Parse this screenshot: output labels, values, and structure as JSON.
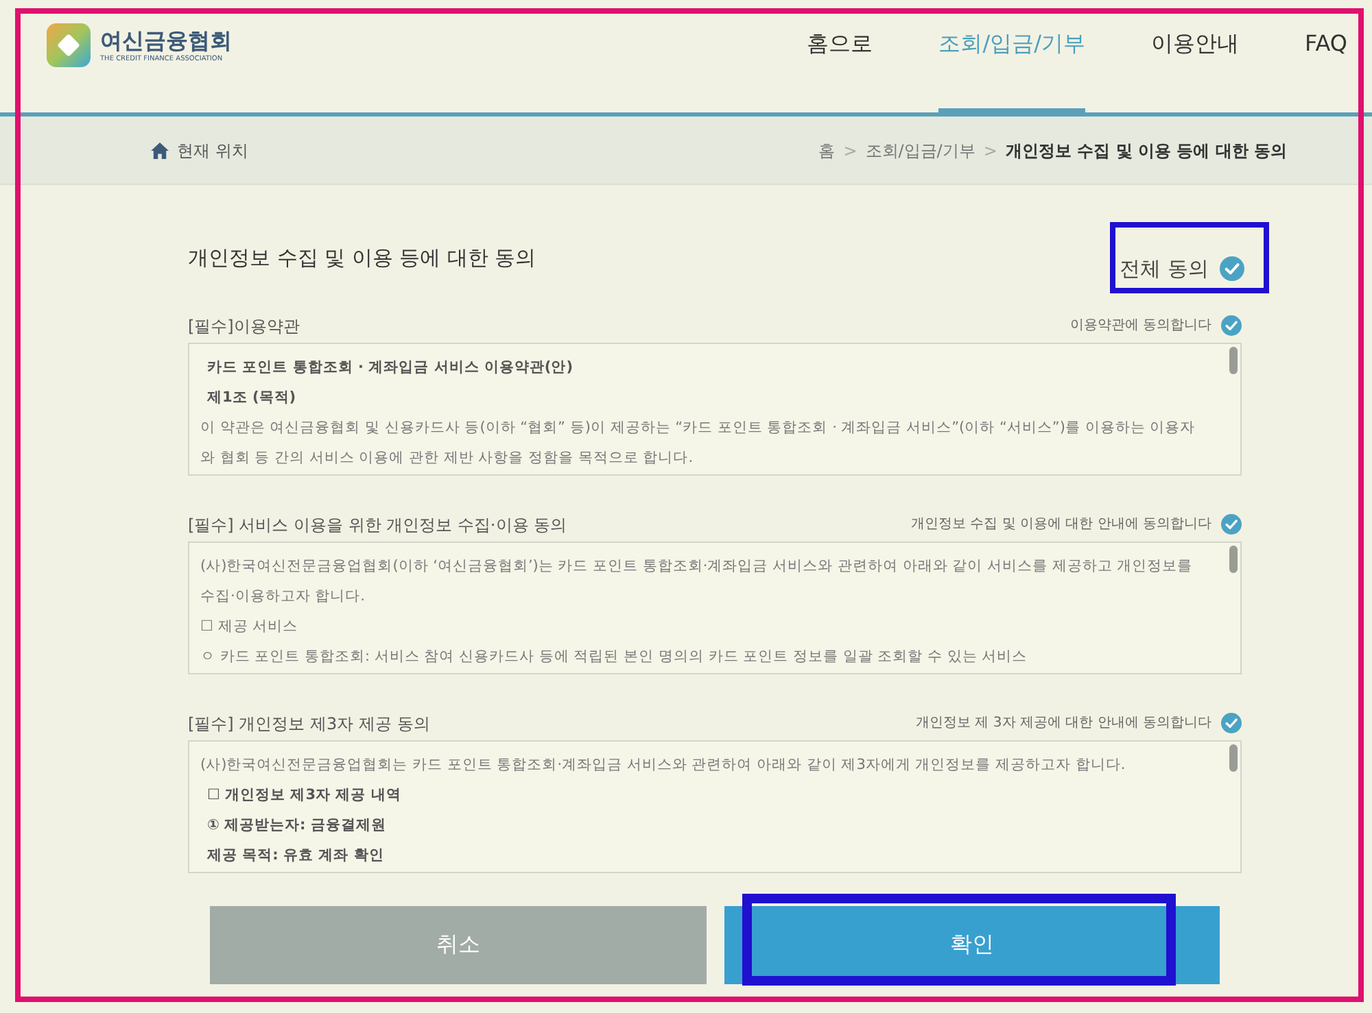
{
  "header": {
    "logo": {
      "name": "여신금융협회",
      "subtitle": "THE CREDIT FINANCE ASSOCIATION"
    },
    "nav": [
      {
        "label": "홈으로",
        "selected": false
      },
      {
        "label": "조회/입금/기부",
        "selected": true
      },
      {
        "label": "이용안내",
        "selected": false
      },
      {
        "label": "FAQ",
        "selected": false
      }
    ]
  },
  "location": {
    "label": "현재 위치",
    "separator": ">",
    "crumbs": [
      {
        "label": "홈",
        "current": false
      },
      {
        "label": "조회/입금/기부",
        "current": false
      },
      {
        "label": "개인정보 수집 및 이용 등에 대한 동의",
        "current": true
      }
    ]
  },
  "consent": {
    "title": "개인정보 수집 및 이용 등에 대한 동의",
    "agree_all": {
      "label": "전체 동의",
      "checked": true
    },
    "sections": [
      {
        "title": "[필수]이용약관",
        "agree_label": "이용약관에 동의합니다",
        "checked": true,
        "lines": [
          {
            "kind": "bold",
            "text": "카드 포인트 통합조회 · 계좌입금 서비스 이용약관(안)"
          },
          {
            "kind": "bold",
            "text": "제1조 (목적)"
          },
          {
            "kind": "plain",
            "text": "이 약관은 여신금융협회 및 신용카드사 등(이하 “협회” 등)이 제공하는 “카드 포인트 통합조회 · 계좌입금 서비스”(이하 “서비스”)를 이용하는 이용자와 협회 등 간의 서비스 이용에 관한 제반 사항을 정함을 목적으로 합니다."
          }
        ]
      },
      {
        "title": "[필수] 서비스 이용을 위한 개인정보 수집·이용 동의",
        "agree_label": "개인정보 수집 및 이용에 대한 안내에 동의합니다",
        "checked": true,
        "lines": [
          {
            "kind": "plain",
            "text": "(사)한국여신전문금융업협회(이하 ‘여신금융협회’)는 카드 포인트 통합조회·계좌입금 서비스와 관련하여 아래와 같이 서비스를 제공하고 개인정보를 수집·이용하고자 합니다."
          },
          {
            "kind": "plain",
            "text": "☐ 제공 서비스"
          },
          {
            "kind": "plain",
            "text": "ㅇ 카드 포인트 통합조회: 서비스 참여 신용카드사 등에 적립된 본인 명의의 카드 포인트 정보를 일괄 조회할 수 있는 서비스"
          }
        ]
      },
      {
        "title": "[필수] 개인정보 제3자 제공 동의",
        "agree_label": "개인정보 제 3자 제공에 대한 안내에 동의합니다",
        "checked": true,
        "lines": [
          {
            "kind": "plain",
            "text": "(사)한국여신전문금융업협회는 카드 포인트 통합조회·계좌입금 서비스와 관련하여 아래와 같이 제3자에게 개인정보를 제공하고자 합니다."
          },
          {
            "kind": "bold",
            "text": "☐ 개인정보 제3자 제공 내역"
          },
          {
            "kind": "bold",
            "text": "① 제공받는자: 금융결제원"
          },
          {
            "kind": "bold",
            "text": "제공 목적: 유효 계좌 확인"
          }
        ]
      }
    ]
  },
  "buttons": [
    {
      "label": "취소",
      "kind": "secondary"
    },
    {
      "label": "확인",
      "kind": "primary"
    }
  ]
}
